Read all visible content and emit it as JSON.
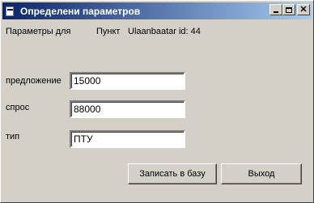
{
  "window": {
    "title": "Определени параметров",
    "minimize_icon": "minimize-icon",
    "maximize_icon": "maximize-icon",
    "close_icon": "close-icon"
  },
  "header": {
    "params_label": "Параметры для",
    "point_label": "Пункт",
    "point_value": "Ulaanbaatar id: 44"
  },
  "form": {
    "supply_label": "предложение",
    "supply_value": "15000",
    "demand_label": "спрос",
    "demand_value": "88000",
    "type_label": "тип",
    "type_value": "ПТУ"
  },
  "buttons": {
    "save_label": "Записать в базу",
    "exit_label": "Выход"
  }
}
